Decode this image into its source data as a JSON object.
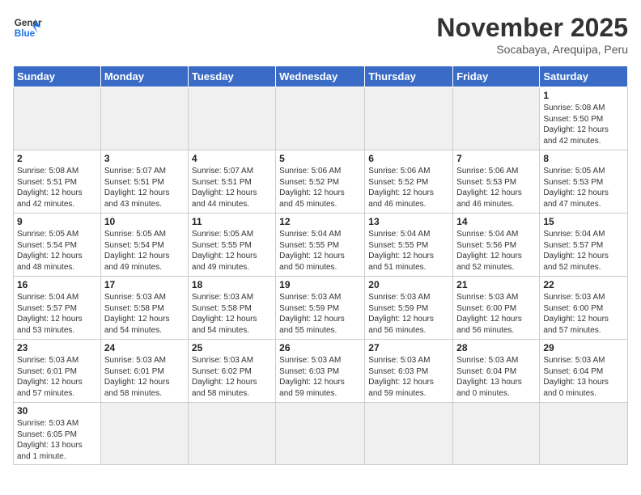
{
  "header": {
    "logo_general": "General",
    "logo_blue": "Blue",
    "month_title": "November 2025",
    "location": "Socabaya, Arequipa, Peru"
  },
  "weekdays": [
    "Sunday",
    "Monday",
    "Tuesday",
    "Wednesday",
    "Thursday",
    "Friday",
    "Saturday"
  ],
  "weeks": [
    [
      {
        "day": "",
        "info": ""
      },
      {
        "day": "",
        "info": ""
      },
      {
        "day": "",
        "info": ""
      },
      {
        "day": "",
        "info": ""
      },
      {
        "day": "",
        "info": ""
      },
      {
        "day": "",
        "info": ""
      },
      {
        "day": "1",
        "info": "Sunrise: 5:08 AM\nSunset: 5:50 PM\nDaylight: 12 hours\nand 42 minutes."
      }
    ],
    [
      {
        "day": "2",
        "info": "Sunrise: 5:08 AM\nSunset: 5:51 PM\nDaylight: 12 hours\nand 42 minutes."
      },
      {
        "day": "3",
        "info": "Sunrise: 5:07 AM\nSunset: 5:51 PM\nDaylight: 12 hours\nand 43 minutes."
      },
      {
        "day": "4",
        "info": "Sunrise: 5:07 AM\nSunset: 5:51 PM\nDaylight: 12 hours\nand 44 minutes."
      },
      {
        "day": "5",
        "info": "Sunrise: 5:06 AM\nSunset: 5:52 PM\nDaylight: 12 hours\nand 45 minutes."
      },
      {
        "day": "6",
        "info": "Sunrise: 5:06 AM\nSunset: 5:52 PM\nDaylight: 12 hours\nand 46 minutes."
      },
      {
        "day": "7",
        "info": "Sunrise: 5:06 AM\nSunset: 5:53 PM\nDaylight: 12 hours\nand 46 minutes."
      },
      {
        "day": "8",
        "info": "Sunrise: 5:05 AM\nSunset: 5:53 PM\nDaylight: 12 hours\nand 47 minutes."
      }
    ],
    [
      {
        "day": "9",
        "info": "Sunrise: 5:05 AM\nSunset: 5:54 PM\nDaylight: 12 hours\nand 48 minutes."
      },
      {
        "day": "10",
        "info": "Sunrise: 5:05 AM\nSunset: 5:54 PM\nDaylight: 12 hours\nand 49 minutes."
      },
      {
        "day": "11",
        "info": "Sunrise: 5:05 AM\nSunset: 5:55 PM\nDaylight: 12 hours\nand 49 minutes."
      },
      {
        "day": "12",
        "info": "Sunrise: 5:04 AM\nSunset: 5:55 PM\nDaylight: 12 hours\nand 50 minutes."
      },
      {
        "day": "13",
        "info": "Sunrise: 5:04 AM\nSunset: 5:55 PM\nDaylight: 12 hours\nand 51 minutes."
      },
      {
        "day": "14",
        "info": "Sunrise: 5:04 AM\nSunset: 5:56 PM\nDaylight: 12 hours\nand 52 minutes."
      },
      {
        "day": "15",
        "info": "Sunrise: 5:04 AM\nSunset: 5:57 PM\nDaylight: 12 hours\nand 52 minutes."
      }
    ],
    [
      {
        "day": "16",
        "info": "Sunrise: 5:04 AM\nSunset: 5:57 PM\nDaylight: 12 hours\nand 53 minutes."
      },
      {
        "day": "17",
        "info": "Sunrise: 5:03 AM\nSunset: 5:58 PM\nDaylight: 12 hours\nand 54 minutes."
      },
      {
        "day": "18",
        "info": "Sunrise: 5:03 AM\nSunset: 5:58 PM\nDaylight: 12 hours\nand 54 minutes."
      },
      {
        "day": "19",
        "info": "Sunrise: 5:03 AM\nSunset: 5:59 PM\nDaylight: 12 hours\nand 55 minutes."
      },
      {
        "day": "20",
        "info": "Sunrise: 5:03 AM\nSunset: 5:59 PM\nDaylight: 12 hours\nand 56 minutes."
      },
      {
        "day": "21",
        "info": "Sunrise: 5:03 AM\nSunset: 6:00 PM\nDaylight: 12 hours\nand 56 minutes."
      },
      {
        "day": "22",
        "info": "Sunrise: 5:03 AM\nSunset: 6:00 PM\nDaylight: 12 hours\nand 57 minutes."
      }
    ],
    [
      {
        "day": "23",
        "info": "Sunrise: 5:03 AM\nSunset: 6:01 PM\nDaylight: 12 hours\nand 57 minutes."
      },
      {
        "day": "24",
        "info": "Sunrise: 5:03 AM\nSunset: 6:01 PM\nDaylight: 12 hours\nand 58 minutes."
      },
      {
        "day": "25",
        "info": "Sunrise: 5:03 AM\nSunset: 6:02 PM\nDaylight: 12 hours\nand 58 minutes."
      },
      {
        "day": "26",
        "info": "Sunrise: 5:03 AM\nSunset: 6:03 PM\nDaylight: 12 hours\nand 59 minutes."
      },
      {
        "day": "27",
        "info": "Sunrise: 5:03 AM\nSunset: 6:03 PM\nDaylight: 12 hours\nand 59 minutes."
      },
      {
        "day": "28",
        "info": "Sunrise: 5:03 AM\nSunset: 6:04 PM\nDaylight: 13 hours\nand 0 minutes."
      },
      {
        "day": "29",
        "info": "Sunrise: 5:03 AM\nSunset: 6:04 PM\nDaylight: 13 hours\nand 0 minutes."
      }
    ],
    [
      {
        "day": "30",
        "info": "Sunrise: 5:03 AM\nSunset: 6:05 PM\nDaylight: 13 hours\nand 1 minute."
      },
      {
        "day": "",
        "info": ""
      },
      {
        "day": "",
        "info": ""
      },
      {
        "day": "",
        "info": ""
      },
      {
        "day": "",
        "info": ""
      },
      {
        "day": "",
        "info": ""
      },
      {
        "day": "",
        "info": ""
      }
    ]
  ]
}
